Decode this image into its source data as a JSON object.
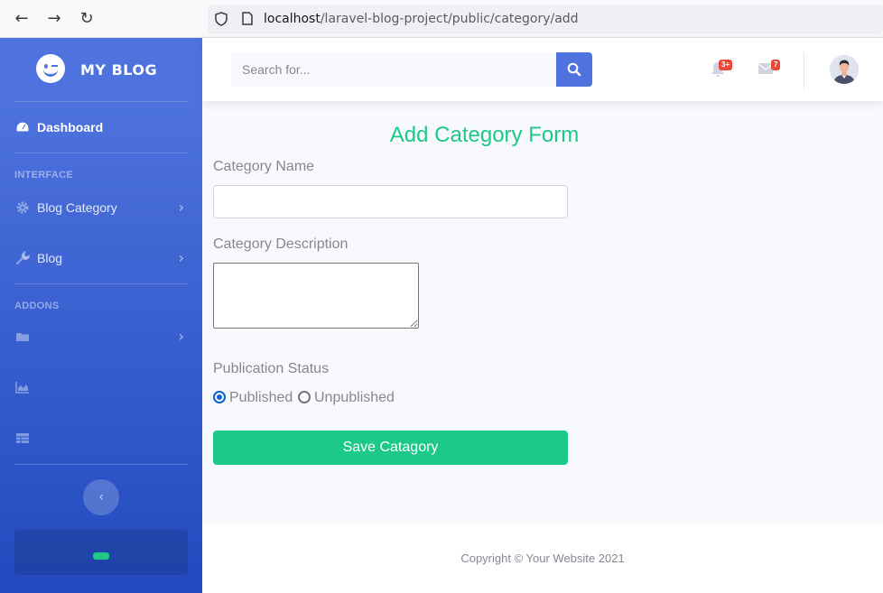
{
  "browser": {
    "url_host": "localhost",
    "url_path": "/laravel-blog-project/public/category/add"
  },
  "sidebar": {
    "brand": "MY BLOG",
    "dashboard": "Dashboard",
    "heading_interface": "INTERFACE",
    "blog_category": "Blog Category",
    "blog": "Blog",
    "heading_addons": "ADDONS"
  },
  "topbar": {
    "search_placeholder": "Search for...",
    "alerts_count": "3+",
    "messages_count": "7"
  },
  "form": {
    "title": "Add Category Form",
    "name_label": "Category Name",
    "name_value": "",
    "description_label": "Category Description",
    "status_label": "Publication Status",
    "option_published": "Published",
    "option_unpublished": "Unpublished",
    "selected_status": "Published",
    "submit_label": "Save Catagory"
  },
  "footer": {
    "copyright": "Copyright © Your Website 2021"
  },
  "colors": {
    "primary": "#4e73df",
    "success": "#1cc88a",
    "danger": "#e74a3b"
  }
}
